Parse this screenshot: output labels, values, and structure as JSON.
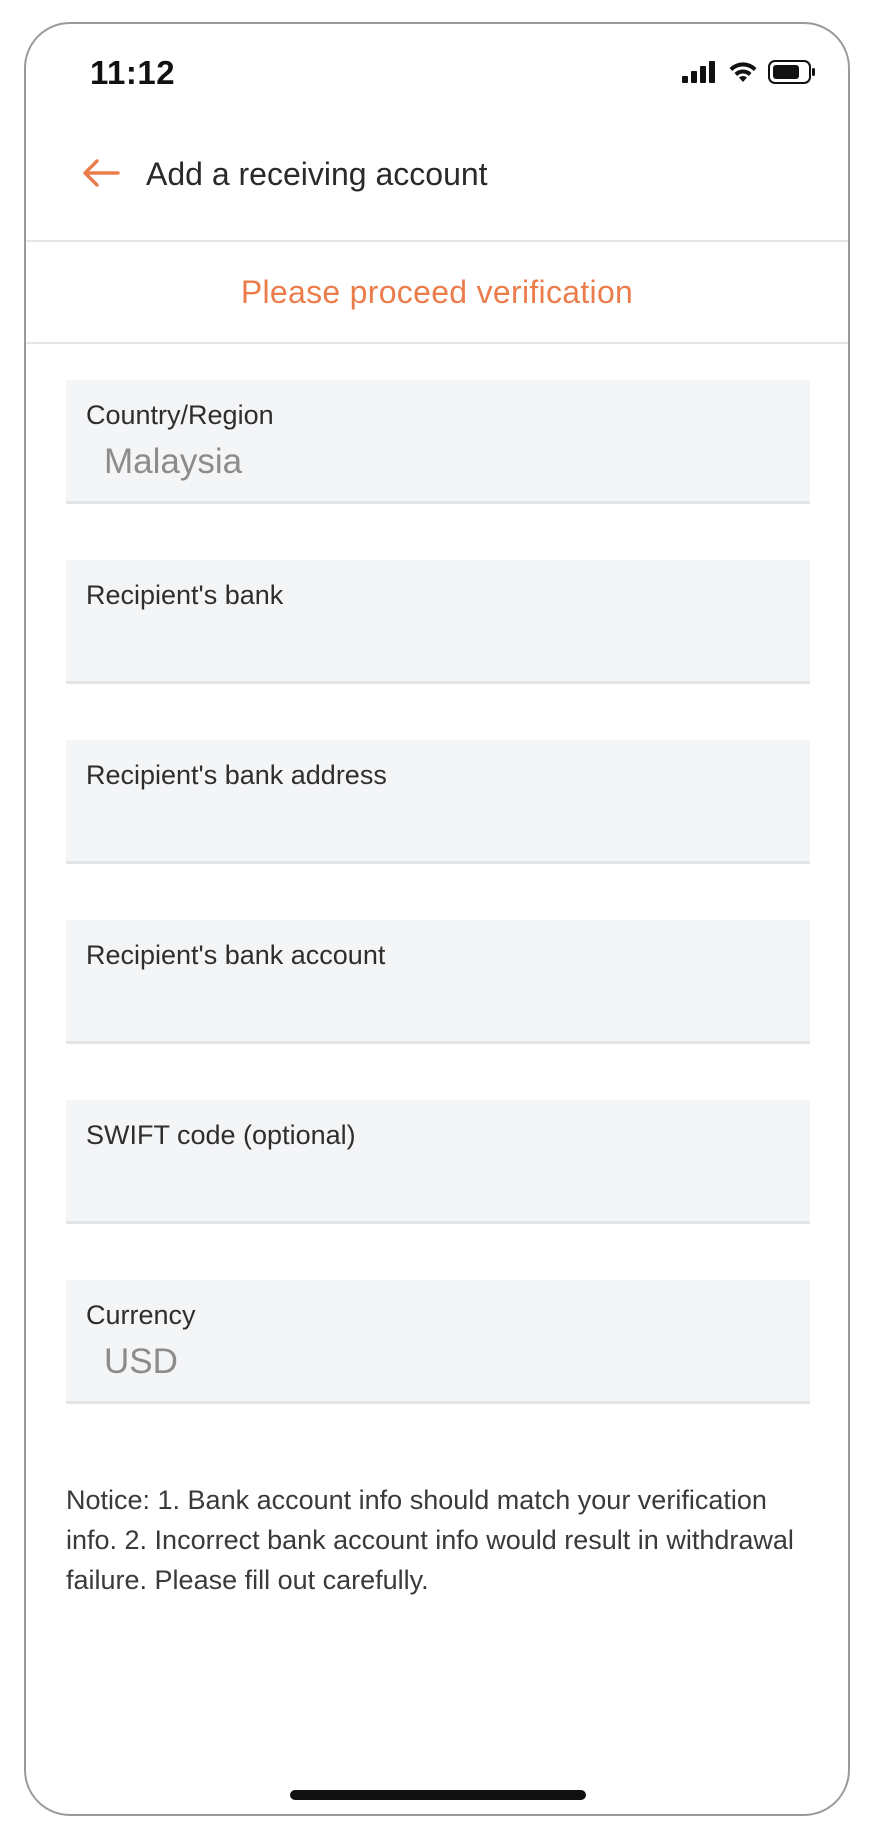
{
  "status_bar": {
    "time": "11:12",
    "icons": [
      "signal-icon",
      "wifi-icon",
      "battery-icon"
    ]
  },
  "header": {
    "back_icon": "arrow-left-icon",
    "title": "Add a receiving account"
  },
  "banner": {
    "text": "Please proceed verification"
  },
  "form": {
    "fields": [
      {
        "label": "Country/Region",
        "value": "Malaysia"
      },
      {
        "label": "Recipient's bank",
        "value": ""
      },
      {
        "label": "Recipient's bank address",
        "value": ""
      },
      {
        "label": "Recipient's bank account",
        "value": ""
      },
      {
        "label": "SWIFT code (optional)",
        "value": ""
      },
      {
        "label": "Currency",
        "value": "USD"
      }
    ]
  },
  "notice": "Notice: 1. Bank account info should match your verification info. 2. Incorrect bank account info would result in withdrawal failure. Please fill out carefully.",
  "colors": {
    "accent": "#eb7d4c",
    "field_bg": "#f4f5f7",
    "text": "#2e2e2e",
    "value_text": "#8c8c8c"
  }
}
